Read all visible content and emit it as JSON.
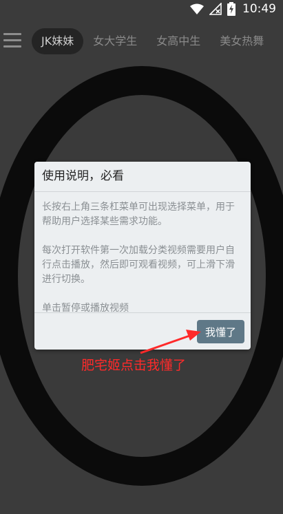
{
  "status_bar": {
    "time": "10:49",
    "icons": [
      "wifi-icon",
      "no-signal-icon",
      "battery-charging-icon"
    ]
  },
  "nav": {
    "menu_icon": "hamburger-menu-icon",
    "tabs": [
      {
        "label": "JK妹妹",
        "active": true
      },
      {
        "label": "女大学生",
        "active": false
      },
      {
        "label": "女高中生",
        "active": false
      },
      {
        "label": "美女热舞",
        "active": false
      }
    ]
  },
  "dialog": {
    "title": "使用说明，必看",
    "paragraphs": [
      "长按右上角三条杠菜单可出现选择菜单，用于帮助用户选择某些需求功能。",
      "每次打开软件第一次加载分类视频需要用户自行点击播放，然后即可观看视频，可上滑下滑进行切换。",
      "单击暂停或播放视频"
    ],
    "ok_label": "我懂了"
  },
  "annotation": {
    "text": "肥宅姬点击我懂了",
    "color": "#ff2a2a"
  },
  "colors": {
    "button": "#5f7887",
    "dialog_bg": "#eceff1",
    "background": "#3b3b3b"
  }
}
